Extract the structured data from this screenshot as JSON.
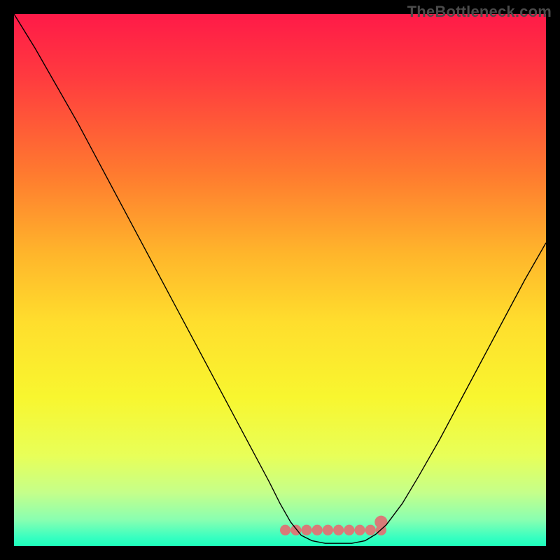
{
  "watermark": "TheBottleneck.com",
  "chart_data": {
    "type": "line",
    "title": "",
    "xlabel": "",
    "ylabel": "",
    "xlim": [
      0,
      100
    ],
    "ylim": [
      0,
      100
    ],
    "grid": false,
    "legend": false,
    "background_gradient": {
      "direction": "vertical",
      "stops": [
        {
          "offset": 0.0,
          "color": "#ff1a48"
        },
        {
          "offset": 0.12,
          "color": "#ff3b3f"
        },
        {
          "offset": 0.3,
          "color": "#ff7a2f"
        },
        {
          "offset": 0.45,
          "color": "#ffb52b"
        },
        {
          "offset": 0.58,
          "color": "#ffde2d"
        },
        {
          "offset": 0.72,
          "color": "#f8f62f"
        },
        {
          "offset": 0.83,
          "color": "#e8ff58"
        },
        {
          "offset": 0.9,
          "color": "#c5ff8a"
        },
        {
          "offset": 0.95,
          "color": "#8affb0"
        },
        {
          "offset": 0.985,
          "color": "#35ffc1"
        },
        {
          "offset": 1.0,
          "color": "#1effb9"
        }
      ]
    },
    "series": [
      {
        "name": "bottleneck-curve",
        "color": "#000000",
        "width": 1.4,
        "points": [
          {
            "x": 0.0,
            "y": 100.0
          },
          {
            "x": 4.0,
            "y": 93.5
          },
          {
            "x": 8.0,
            "y": 86.5
          },
          {
            "x": 12.0,
            "y": 79.5
          },
          {
            "x": 16.0,
            "y": 72.0
          },
          {
            "x": 20.0,
            "y": 64.5
          },
          {
            "x": 24.0,
            "y": 57.0
          },
          {
            "x": 28.0,
            "y": 49.5
          },
          {
            "x": 32.0,
            "y": 42.0
          },
          {
            "x": 36.0,
            "y": 34.5
          },
          {
            "x": 40.0,
            "y": 27.0
          },
          {
            "x": 44.0,
            "y": 19.5
          },
          {
            "x": 48.0,
            "y": 12.0
          },
          {
            "x": 50.0,
            "y": 8.0
          },
          {
            "x": 52.0,
            "y": 4.5
          },
          {
            "x": 54.0,
            "y": 2.0
          },
          {
            "x": 56.0,
            "y": 1.0
          },
          {
            "x": 58.5,
            "y": 0.5
          },
          {
            "x": 61.0,
            "y": 0.5
          },
          {
            "x": 63.5,
            "y": 0.5
          },
          {
            "x": 66.0,
            "y": 1.0
          },
          {
            "x": 68.0,
            "y": 2.2
          },
          {
            "x": 70.0,
            "y": 4.0
          },
          {
            "x": 73.0,
            "y": 8.0
          },
          {
            "x": 76.0,
            "y": 13.0
          },
          {
            "x": 80.0,
            "y": 20.0
          },
          {
            "x": 84.0,
            "y": 27.5
          },
          {
            "x": 88.0,
            "y": 35.0
          },
          {
            "x": 92.0,
            "y": 42.5
          },
          {
            "x": 96.0,
            "y": 50.0
          },
          {
            "x": 100.0,
            "y": 57.0
          }
        ]
      },
      {
        "name": "optimal-band-marker",
        "color": "#d87b78",
        "type": "marker-band",
        "y": 3.0,
        "points_x": [
          51.0,
          53.0,
          55.0,
          57.0,
          59.0,
          61.0,
          63.0,
          65.0,
          67.0,
          69.0
        ],
        "highlight_point": {
          "x": 69.0,
          "y": 4.5,
          "r": 1.2
        }
      }
    ]
  }
}
